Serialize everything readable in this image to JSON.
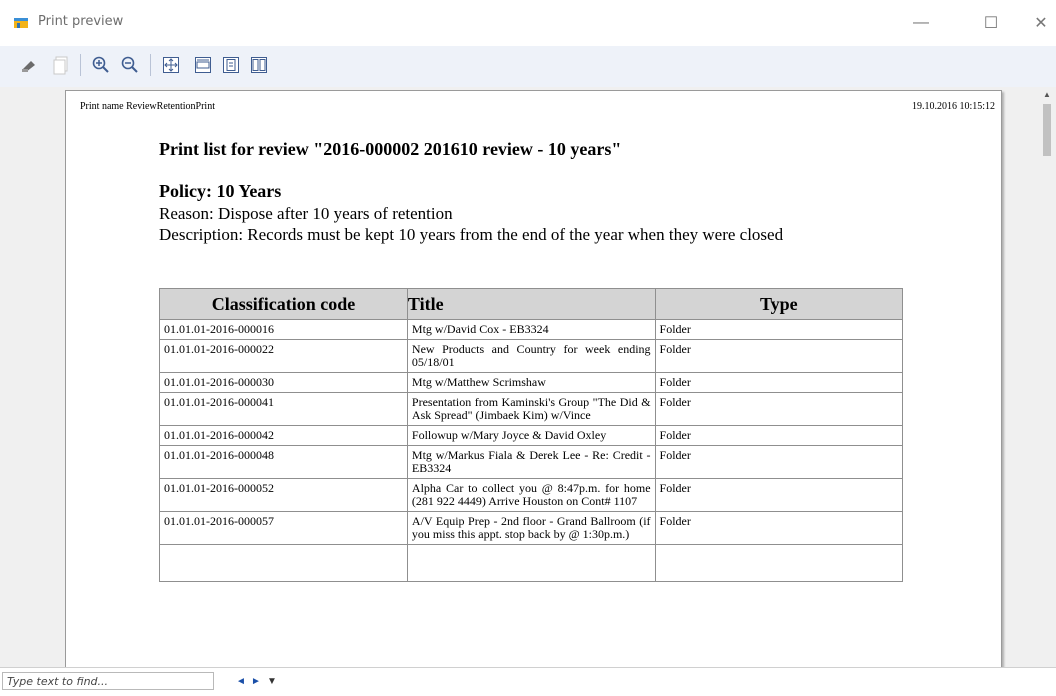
{
  "window": {
    "title": "Print preview",
    "minimize_label": "—",
    "maximize_label": "☐",
    "close_label": "✕"
  },
  "toolbar": {
    "buttons": [
      "print",
      "copy",
      "zoom-in",
      "zoom-out",
      "fit-page",
      "fit-width",
      "single-page",
      "two-pages"
    ]
  },
  "page": {
    "print_name": "Print name ReviewRetentionPrint",
    "print_date": "19.10.2016 10:15:12",
    "heading": "Print list for review \"2016-000002 201610 review - 10 years\"",
    "policy": "Policy: 10 Years",
    "reason": "Reason: Dispose after 10 years of retention",
    "description": "Description: Records must be kept 10 years from the end of the year when they were closed"
  },
  "table": {
    "headers": [
      "Classification code",
      "Title",
      "Type"
    ],
    "rows": [
      {
        "code": "01.01.01-2016-000016",
        "title": "Mtg w/David Cox - EB3324",
        "type": "Folder"
      },
      {
        "code": "01.01.01-2016-000022",
        "title": "New Products and Country for week ending 05/18/01",
        "type": "Folder"
      },
      {
        "code": "01.01.01-2016-000030",
        "title": "Mtg w/Matthew Scrimshaw",
        "type": "Folder"
      },
      {
        "code": "01.01.01-2016-000041",
        "title": "Presentation from Kaminski's Group \"The Did & Ask Spread\" (Jimbaek Kim) w/Vince",
        "type": "Folder"
      },
      {
        "code": "01.01.01-2016-000042",
        "title": "Followup w/Mary Joyce & David Oxley",
        "type": "Folder"
      },
      {
        "code": "01.01.01-2016-000048",
        "title": "Mtg w/Markus Fiala & Derek Lee - Re: Credit - EB3324",
        "type": "Folder"
      },
      {
        "code": "01.01.01-2016-000052",
        "title": "Alpha Car to collect you @ 8:47p.m. for home (281 922 4449)  Arrive Houston  on Cont# 1107",
        "type": "Folder"
      },
      {
        "code": "01.01.01-2016-000057",
        "title": "A/V Equip Prep - 2nd floor - Grand Ballroom  (if you miss this appt. stop back  by @ 1:30p.m.)",
        "type": "Folder"
      }
    ]
  },
  "find": {
    "placeholder": "Type text to find...",
    "prev": "◄",
    "next": "►",
    "options": "▼"
  }
}
